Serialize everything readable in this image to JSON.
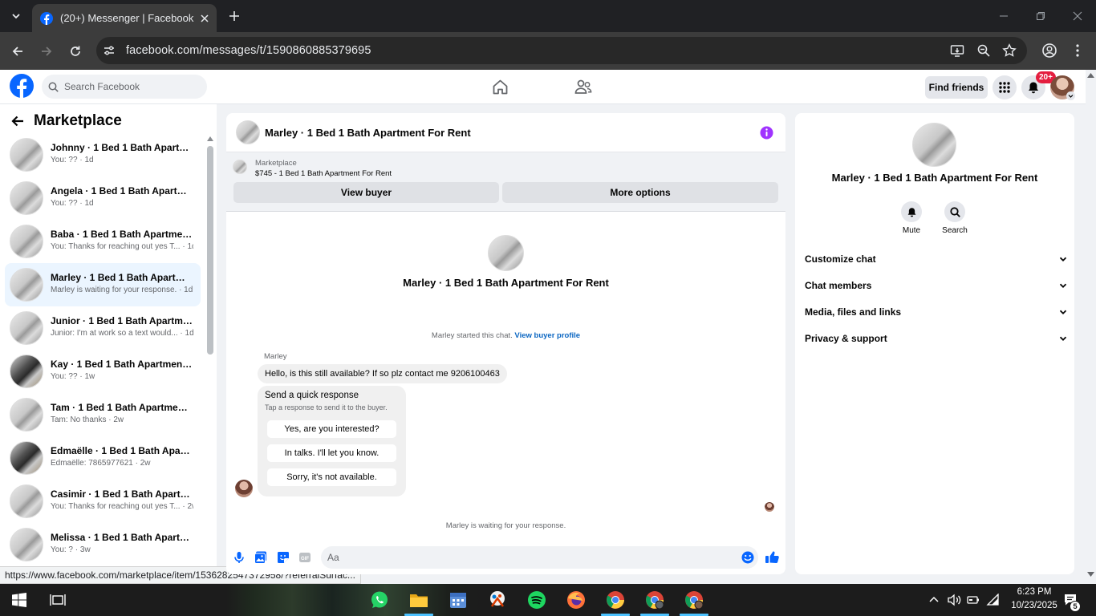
{
  "browser": {
    "tab_title": "(20+) Messenger | Facebook",
    "url": "facebook.com/messages/t/1590860885379695",
    "status_url": "https://www.facebook.com/marketplace/item/1536282547372958/?referralSurfac..."
  },
  "fb_header": {
    "search_placeholder": "Search Facebook",
    "find_friends": "Find friends",
    "notification_badge": "20+"
  },
  "left_panel": {
    "title": "Marketplace",
    "conversations": [
      {
        "name": "Johnny · 1 Bed 1 Bath Apartmen...",
        "preview": "You: ?? · 1d"
      },
      {
        "name": "Angela · 1 Bed 1 Bath Apartmen...",
        "preview": "You: ?? · 1d"
      },
      {
        "name": "Baba · 1 Bed 1 Bath Apartment ...",
        "preview": "You: Thanks for reaching out yes T... · 1d"
      },
      {
        "name": "Marley · 1 Bed 1 Bath Apartmen...",
        "preview": "Marley is waiting for your response. · 1d"
      },
      {
        "name": "Junior · 1 Bed 1 Bath Apartment...",
        "preview": "Junior: I'm at work so a text would... · 1d"
      },
      {
        "name": "Kay · 1 Bed 1 Bath Apartment F...",
        "preview": "You: ?? · 1w"
      },
      {
        "name": "Tam · 1 Bed 1 Bath Apartment F...",
        "preview": "Tam: No thanks · 2w"
      },
      {
        "name": "Edmaëlle · 1 Bed 1 Bath Apartm...",
        "preview": "Edmaëlle: 7865977621 · 2w"
      },
      {
        "name": "Casimir · 1 Bed 1 Bath Apartme...",
        "preview": "You: Thanks for reaching out yes T... · 2w"
      },
      {
        "name": "Melissa · 1 Bed 1 Bath Apartme...",
        "preview": "You: ? · 3w"
      }
    ]
  },
  "chat": {
    "title": "Marley · 1 Bed 1 Bath Apartment For Rent",
    "listing_label": "Marketplace",
    "listing_title": "$745 - 1 Bed 1 Bath Apartment For Rent",
    "view_buyer": "View buyer",
    "more_options": "More options",
    "intro_name": "Marley · 1 Bed 1 Bath Apartment For Rent",
    "started_text": "Marley started this chat.",
    "view_buyer_profile": "View buyer profile",
    "sender": "Marley",
    "message": "Hello, is this still available? If so plz contact me 9206100463",
    "quick_title": "Send a quick response",
    "quick_subtitle": "Tap a response to send it to the buyer.",
    "quick_responses": [
      "Yes, are you interested?",
      "In talks. I'll let you know.",
      "Sorry, it's not available."
    ],
    "waiting_text": "Marley is waiting for your response.",
    "composer_placeholder": "Aa"
  },
  "right_panel": {
    "name": "Marley · 1 Bed 1 Bath Apartment For Rent",
    "mute": "Mute",
    "search": "Search",
    "sections": [
      "Customize chat",
      "Chat members",
      "Media, files and links",
      "Privacy & support"
    ]
  },
  "taskbar": {
    "time": "6:23 PM",
    "date": "10/23/2025",
    "notification_count": "5"
  },
  "colors": {
    "fb_blue": "#0866ff",
    "accent_purple": "#a033ff",
    "active_row": "#ebf5ff",
    "badge_red": "#e41e3f"
  }
}
